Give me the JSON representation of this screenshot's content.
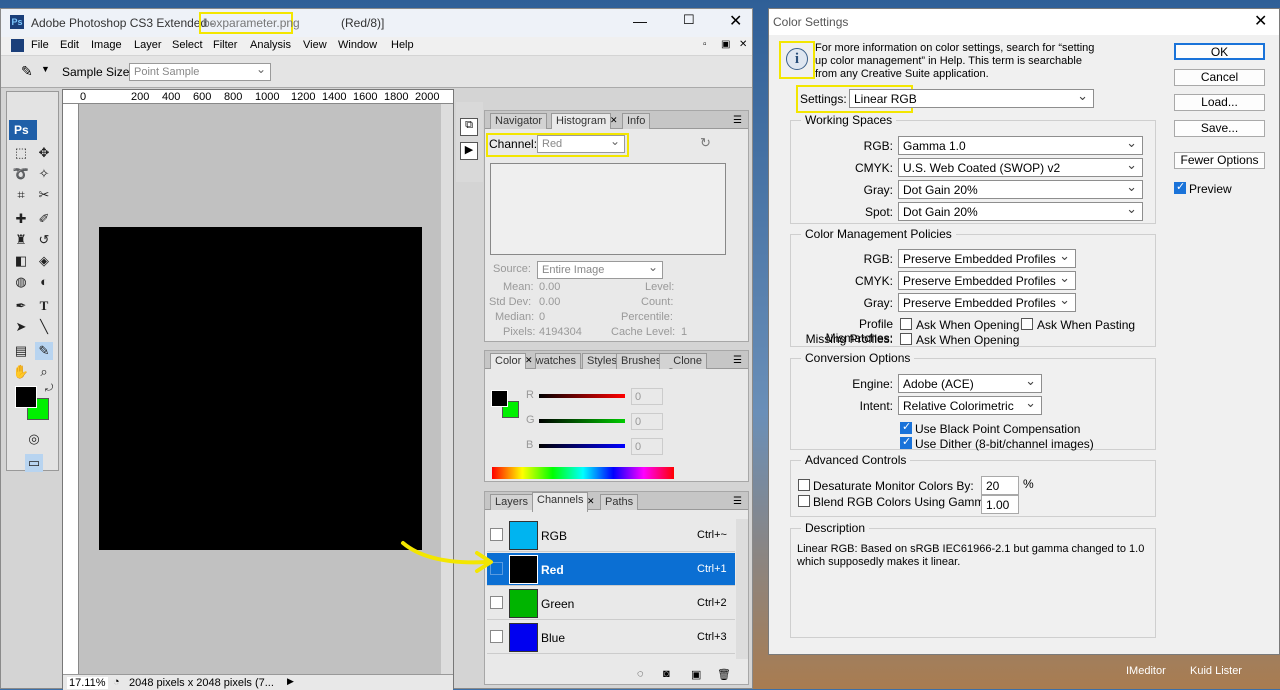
{
  "photoshop": {
    "app_title": "Adobe Photoshop CS3 Extended -",
    "file_name": "boxparameter.png",
    "mode": "(Red/8)]",
    "menu": [
      "File",
      "Edit",
      "Image",
      "Layer",
      "Select",
      "Filter",
      "Analysis",
      "View",
      "Window",
      "Help"
    ],
    "options": {
      "sample_size_label": "Sample Size:",
      "sample_size_value": "Point Sample"
    },
    "ruler_top": [
      "0",
      "200",
      "400",
      "600",
      "800",
      "1000",
      "1200",
      "1400",
      "1600",
      "1800",
      "2000"
    ],
    "zoom": "17.11%",
    "doc_info": "2048 pixels x 2048 pixels (7...",
    "ps_logo": "Ps",
    "histogram": {
      "tabs": [
        "Navigator",
        "Histogram",
        "Info"
      ],
      "channel_label": "Channel:",
      "channel_value": "Red",
      "source_label": "Source:",
      "source_value": "Entire Image",
      "stats_left": [
        {
          "k": "Mean:",
          "v": "0.00"
        },
        {
          "k": "Std Dev:",
          "v": "0.00"
        },
        {
          "k": "Median:",
          "v": "0"
        },
        {
          "k": "Pixels:",
          "v": "4194304"
        }
      ],
      "stats_right": [
        {
          "k": "Level:",
          "v": ""
        },
        {
          "k": "Count:",
          "v": ""
        },
        {
          "k": "Percentile:",
          "v": ""
        },
        {
          "k": "Cache Level:",
          "v": "1"
        }
      ]
    },
    "color_panel": {
      "tabs": [
        "Color",
        "Swatches",
        "Styles",
        "Brushes",
        "Clone Source"
      ],
      "sliders": [
        {
          "label": "R",
          "value": "0"
        },
        {
          "label": "G",
          "value": "0"
        },
        {
          "label": "B",
          "value": "0"
        }
      ]
    },
    "channels_panel": {
      "tabs": [
        "Layers",
        "Channels",
        "Paths"
      ],
      "rows": [
        {
          "name": "RGB",
          "shortcut": "Ctrl+~",
          "color": "#00b4f0"
        },
        {
          "name": "Red",
          "shortcut": "Ctrl+1",
          "color": "#000000"
        },
        {
          "name": "Green",
          "shortcut": "Ctrl+2",
          "color": "#00b400"
        },
        {
          "name": "Blue",
          "shortcut": "Ctrl+3",
          "color": "#0000f0"
        }
      ]
    }
  },
  "color_settings": {
    "title": "Color Settings",
    "info": "For more information on color settings, search for “setting up color management” in Help. This term is searchable from any Creative Suite application.",
    "settings_label": "Settings:",
    "settings_value": "Linear RGB",
    "working_spaces": {
      "title": "Working Spaces",
      "rgb_label": "RGB:",
      "rgb": "Gamma 1.0",
      "cmyk_label": "CMYK:",
      "cmyk": "U.S. Web Coated (SWOP) v2",
      "gray_label": "Gray:",
      "gray": "Dot Gain 20%",
      "spot_label": "Spot:",
      "spot": "Dot Gain 20%"
    },
    "policies": {
      "title": "Color Management Policies",
      "rgb_label": "RGB:",
      "rgb": "Preserve Embedded Profiles",
      "cmyk_label": "CMYK:",
      "cmyk": "Preserve Embedded Profiles",
      "gray_label": "Gray:",
      "gray": "Preserve Embedded Profiles",
      "mismatch_label": "Profile Mismatches:",
      "ask_opening": "Ask When Opening",
      "ask_pasting": "Ask When Pasting",
      "missing_label": "Missing Profiles:",
      "ask_opening2": "Ask When Opening"
    },
    "conversion": {
      "title": "Conversion Options",
      "engine_label": "Engine:",
      "engine": "Adobe (ACE)",
      "intent_label": "Intent:",
      "intent": "Relative Colorimetric",
      "bpc": "Use Black Point Compensation",
      "dither": "Use Dither (8-bit/channel images)"
    },
    "advanced": {
      "title": "Advanced Controls",
      "desaturate": "Desaturate Monitor Colors By:",
      "desaturate_value": "20",
      "percent": "%",
      "blend": "Blend RGB Colors Using Gamma:",
      "blend_value": "1.00"
    },
    "description": {
      "title": "Description",
      "text": "Linear RGB:  Based on sRGB IEC61966-2.1 but gamma changed to 1.0 which supposedly makes it linear."
    },
    "buttons": {
      "ok": "OK",
      "cancel": "Cancel",
      "load": "Load...",
      "save": "Save...",
      "fewer": "Fewer Options",
      "preview": "Preview"
    }
  },
  "taskbar": {
    "app1": "IMeditor",
    "app2": "Kuid Lister"
  }
}
